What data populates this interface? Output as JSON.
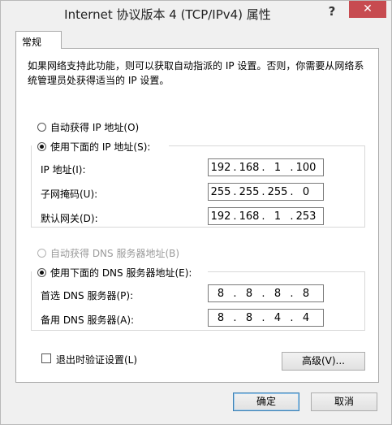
{
  "window": {
    "title": "Internet 协议版本 4 (TCP/IPv4) 属性",
    "help_glyph": "?",
    "close_glyph": "✕"
  },
  "tab": {
    "label": "常规"
  },
  "description": "如果网络支持此功能，则可以获取自动指派的 IP 设置。否则，你需要从网络系统管理员处获得适当的 IP 设置。",
  "ip_section": {
    "auto_label": "自动获得 IP 地址(O)",
    "manual_label": "使用下面的 IP 地址(S):",
    "ip_label": "IP 地址(I):",
    "ip": [
      "192",
      "168",
      "1",
      "100"
    ],
    "mask_label": "子网掩码(U):",
    "mask": [
      "255",
      "255",
      "255",
      "0"
    ],
    "gateway_label": "默认网关(D):",
    "gateway": [
      "192",
      "168",
      "1",
      "253"
    ]
  },
  "dns_section": {
    "auto_label": "自动获得 DNS 服务器地址(B)",
    "manual_label": "使用下面的 DNS 服务器地址(E):",
    "preferred_label": "首选 DNS 服务器(P):",
    "preferred": [
      "8",
      "8",
      "8",
      "8"
    ],
    "alternate_label": "备用 DNS 服务器(A):",
    "alternate": [
      "8",
      "8",
      "4",
      "4"
    ]
  },
  "validate_label": "退出时验证设置(L)",
  "advanced_label": "高级(V)...",
  "ok_label": "确定",
  "cancel_label": "取消"
}
